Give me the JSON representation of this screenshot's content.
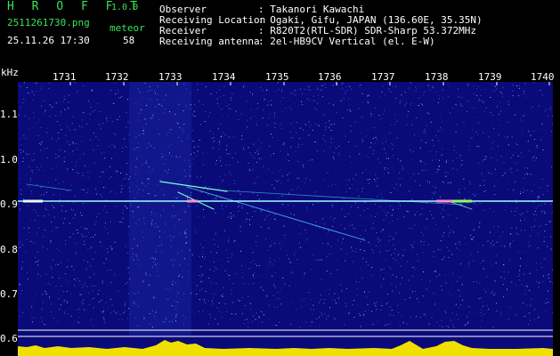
{
  "header": {
    "app_name": "H R O F F T",
    "version": "1.0.0",
    "filename": "2511261730.png",
    "datetime": "25.11.26 17:30",
    "meteor_label": "meteor",
    "meteor_count": "58",
    "fields": [
      {
        "label": "Observer",
        "value": ": Takanori Kawachi"
      },
      {
        "label": "Receiving Location",
        "value": ": Ogaki, Gifu, JAPAN (136.60E, 35.35N)"
      },
      {
        "label": "Receiver",
        "value": ": R820T2(RTL-SDR) SDR-Sharp 53.372MHz"
      },
      {
        "label": "Receiving antenna",
        "value": ": 2el-HB9CV Vertical (el. E-W)"
      }
    ]
  },
  "spectrogram": {
    "unit_label": "kHz",
    "time_ticks": [
      "1731",
      "1732",
      "1733",
      "1734",
      "1735",
      "1736",
      "1737",
      "1738",
      "1739",
      "1740"
    ],
    "freq_ticks": [
      "1.1",
      "1.0",
      "0.9",
      "0.8",
      "0.7",
      "0.6"
    ],
    "colors": {
      "background": "#0a0a78",
      "carrier": "#9ffcff",
      "level": "#f0e000",
      "baseline": "#00e0ff"
    }
  }
}
